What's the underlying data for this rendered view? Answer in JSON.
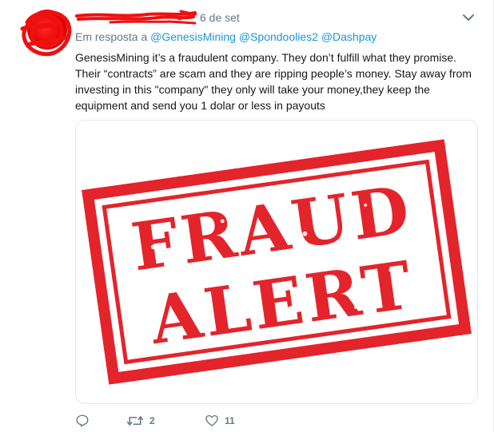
{
  "tweet": {
    "date": "6 de set",
    "reply_prefix": "Em resposta a",
    "reply_handles": [
      "@GenesisMining",
      "@Spondoolies2",
      "@Dashpay"
    ],
    "text": "GenesisMining it’s a fraudulent company. They don’t fulfill what they promise. Their “contracts” are scam and they are ripping people’s money. Stay away from investing in this \"company\" they only will take your money,they keep the equipment and send you 1 dolar or less in payouts",
    "image": {
      "stamp_line1": "FRAUD",
      "stamp_line2": "ALERT",
      "stamp_color": "#e3242b"
    },
    "actions": {
      "reply_icon": "reply-icon",
      "retweet_icon": "retweet-icon",
      "retweet_count": "2",
      "like_icon": "heart-icon",
      "like_count": "11"
    }
  },
  "colors": {
    "link": "#1b95e0",
    "muted": "#657786",
    "redaction": "#ee1111"
  }
}
